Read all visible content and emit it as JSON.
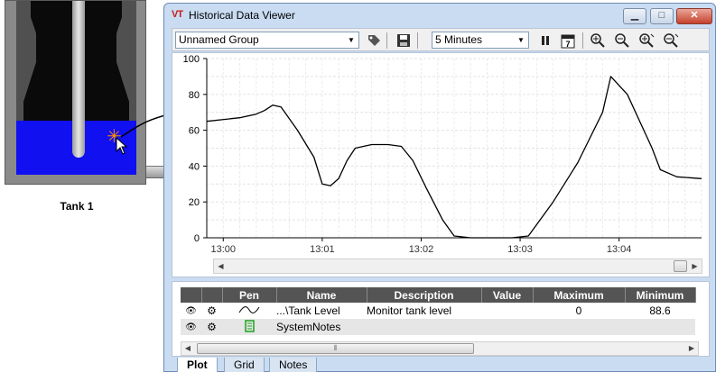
{
  "tank": {
    "label": "Tank 1"
  },
  "window": {
    "logo": "VT",
    "title": "Historical Data Viewer",
    "controls": {
      "minimize": "▁",
      "maximize": "□",
      "close": "✕"
    }
  },
  "toolbar": {
    "group": "Unnamed Group",
    "timespan": "5 Minutes",
    "icons": [
      "tag-icon",
      "save-icon",
      "pause-icon",
      "calendar-icon",
      "zoom-in-icon",
      "zoom-out-icon",
      "zoom-in-x-icon",
      "zoom-out-x-icon"
    ]
  },
  "chart_data": {
    "type": "line",
    "yticks": [
      "100",
      "80",
      "60",
      "40",
      "20",
      "0"
    ],
    "xticks": [
      "13:00",
      "13:01",
      "13:02",
      "13:03",
      "13:04"
    ],
    "ylim": [
      0,
      100
    ],
    "grid": true,
    "series": [
      {
        "name": "...\\Tank Level",
        "x": [
          "12:59:50",
          "13:00:10",
          "13:00:20",
          "13:00:25",
          "13:00:30",
          "13:00:35",
          "13:00:45",
          "13:00:55",
          "13:01:00",
          "13:01:05",
          "13:01:10",
          "13:01:15",
          "13:01:20",
          "13:01:30",
          "13:01:40",
          "13:01:48",
          "13:01:55",
          "13:02:03",
          "13:02:13",
          "13:02:20",
          "13:02:30",
          "13:02:45",
          "13:02:55",
          "13:03:05",
          "13:03:20",
          "13:03:35",
          "13:03:50",
          "13:03:55",
          "13:04:05",
          "13:04:20",
          "13:04:25",
          "13:04:35",
          "13:04:50"
        ],
        "values": [
          65,
          67,
          69,
          71,
          74,
          73,
          60,
          45,
          30,
          29,
          33,
          43,
          50,
          52,
          52,
          51,
          43,
          28,
          10,
          1,
          0,
          0,
          0,
          1,
          20,
          42,
          70,
          90,
          80,
          50,
          38,
          34,
          33
        ]
      }
    ]
  },
  "pens": {
    "headers": [
      "",
      "",
      "Pen",
      "Name",
      "Description",
      "Value",
      "Maximum",
      "Minimum"
    ],
    "rows": [
      {
        "name": "...\\Tank Level",
        "description": "Monitor tank level",
        "value": "",
        "maximum": "0",
        "minimum": "88.6"
      },
      {
        "name": "SystemNotes",
        "description": "",
        "value": "",
        "maximum": "",
        "minimum": ""
      }
    ]
  },
  "tabs": [
    "Plot",
    "Grid",
    "Notes"
  ],
  "colors": {
    "liquid": "#1010f0",
    "header": "#545454",
    "plot_line": "#000000"
  }
}
